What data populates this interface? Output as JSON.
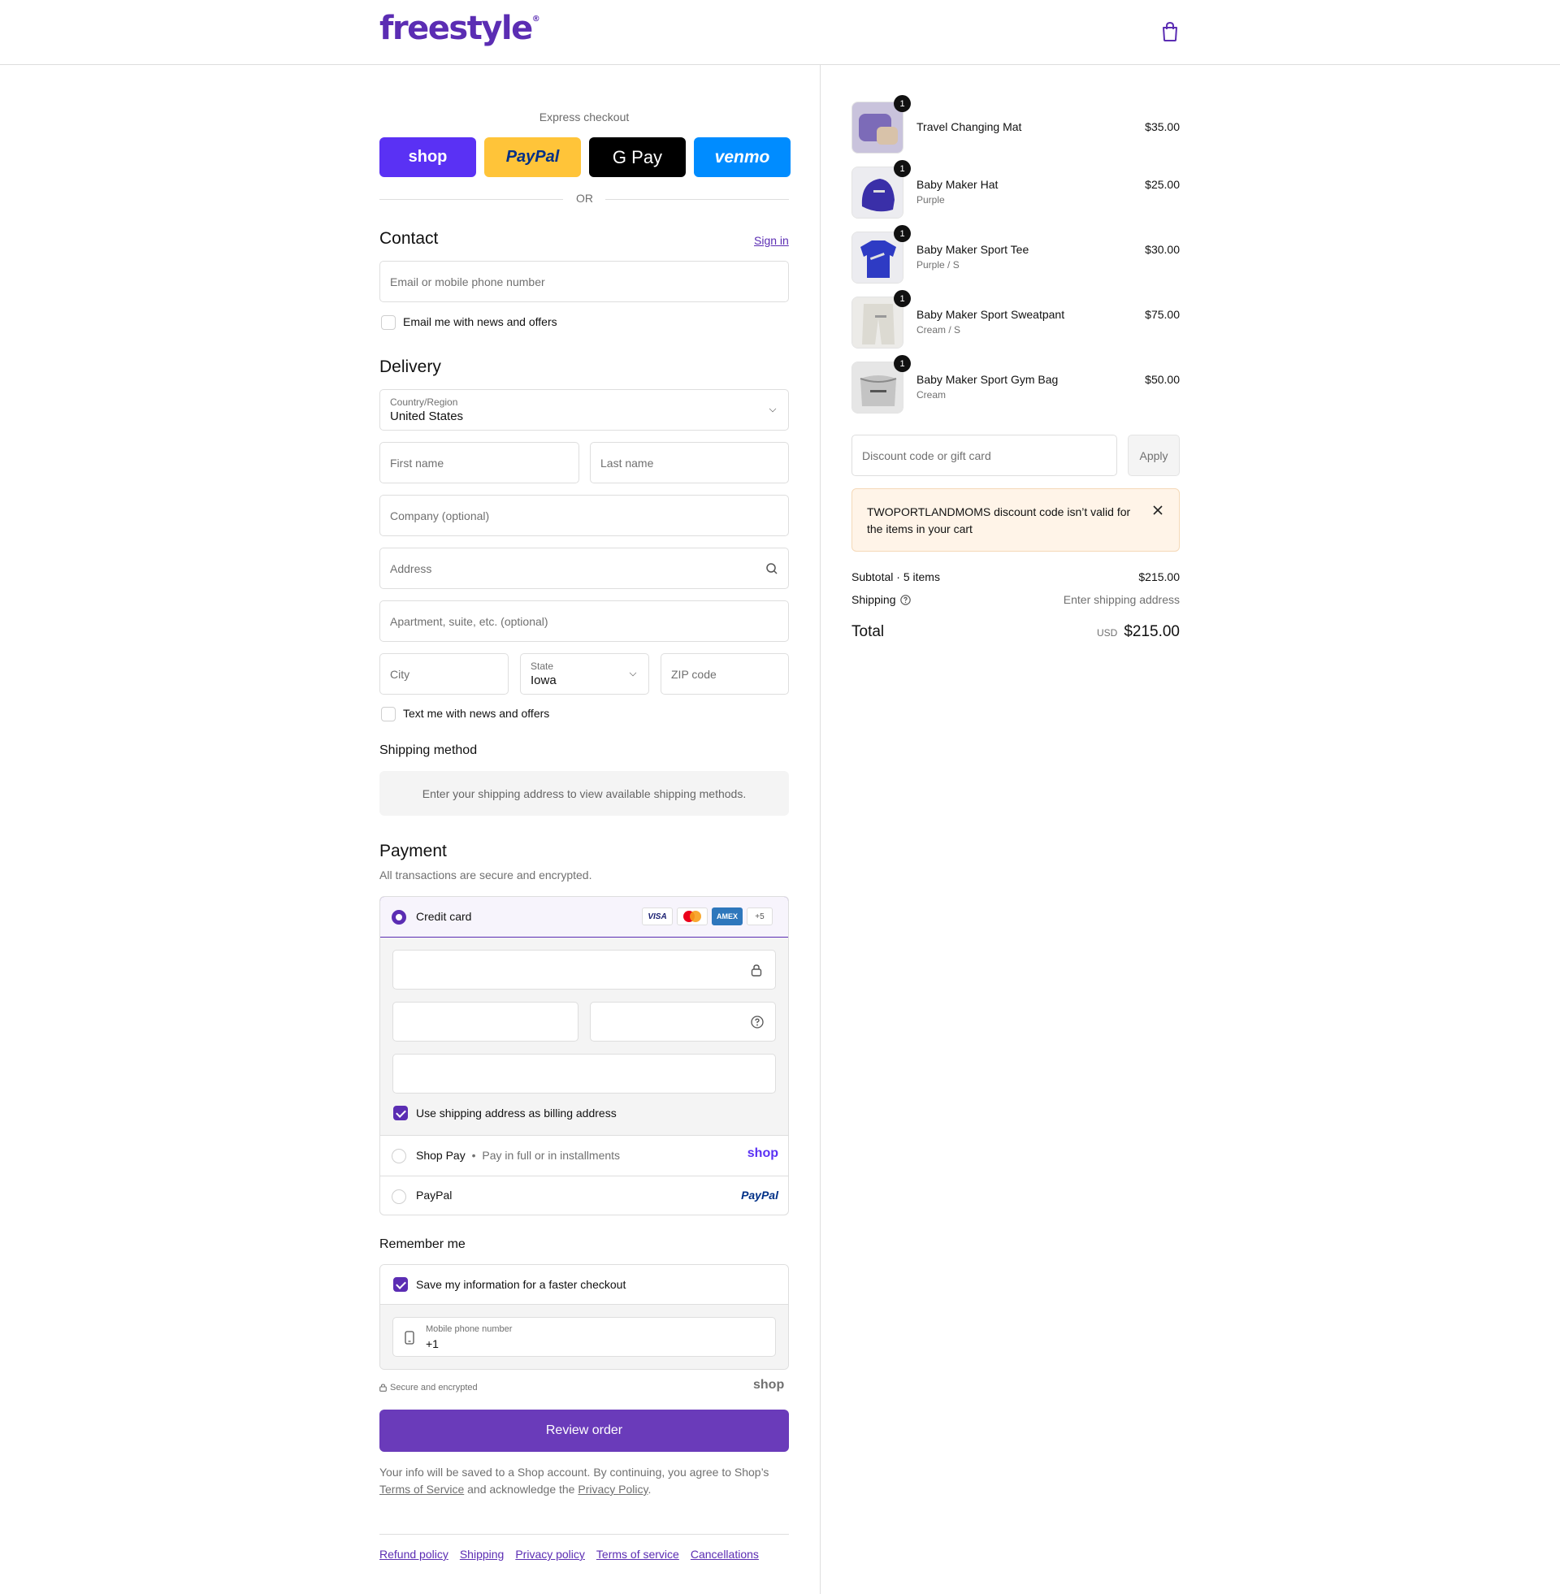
{
  "header": {
    "logo": "freestyle",
    "logo_mark": "®",
    "cart_icon": "shopping-bag-icon"
  },
  "express": {
    "title": "Express checkout",
    "buttons": [
      "shop",
      "PayPal",
      "G Pay",
      "venmo"
    ],
    "divider": "OR"
  },
  "contact": {
    "title": "Contact",
    "sign_in": "Sign in",
    "email_placeholder": "Email or mobile phone number",
    "news_label": "Email me with news and offers"
  },
  "delivery": {
    "title": "Delivery",
    "country_label": "Country/Region",
    "country_value": "United States",
    "first_name": "First name",
    "last_name": "Last name",
    "company": "Company (optional)",
    "address": "Address",
    "apartment": "Apartment, suite, etc. (optional)",
    "city": "City",
    "state_label": "State",
    "state_value": "Iowa",
    "zip": "ZIP code",
    "text_label": "Text me with news and offers"
  },
  "shipping_method": {
    "title": "Shipping method",
    "message": "Enter your shipping address to view available shipping methods."
  },
  "payment": {
    "title": "Payment",
    "subtitle": "All transactions are secure and encrypted.",
    "credit_card": "Credit card",
    "card_brands": [
      "VISA",
      "MC",
      "AMEX",
      "+5"
    ],
    "billing_label": "Use shipping address as billing address",
    "shop_pay": "Shop Pay",
    "shop_pay_sub": "Pay in full or in installments",
    "shop_pay_logo": "shop",
    "paypal": "PayPal",
    "paypal_logo": "PayPal"
  },
  "remember": {
    "title": "Remember me",
    "save_label": "Save my information for a faster checkout",
    "phone_label": "Mobile phone number",
    "phone_value": "+1",
    "secure": "Secure and encrypted",
    "shop_logo": "shop"
  },
  "review_button": "Review order",
  "legal": {
    "line1": "Your info will be saved to a Shop account. By continuing, you agree to Shop’s",
    "terms": "Terms of Service",
    "and_ack": "and acknowledge the",
    "privacy": "Privacy Policy",
    "end": "."
  },
  "footer_links": [
    "Refund policy",
    "Shipping",
    "Privacy policy",
    "Terms of service",
    "Cancellations"
  ],
  "cart": {
    "items": [
      {
        "name": "Travel Changing Mat",
        "variant": "",
        "price": "$35.00",
        "qty": "1"
      },
      {
        "name": "Baby Maker Hat",
        "variant": "Purple",
        "price": "$25.00",
        "qty": "1"
      },
      {
        "name": "Baby Maker Sport Tee",
        "variant": "Purple / S",
        "price": "$30.00",
        "qty": "1"
      },
      {
        "name": "Baby Maker Sport Sweatpant",
        "variant": "Cream / S",
        "price": "$75.00",
        "qty": "1"
      },
      {
        "name": "Baby Maker Sport Gym Bag",
        "variant": "Cream",
        "price": "$50.00",
        "qty": "1"
      }
    ],
    "discount_placeholder": "Discount code or gift card",
    "apply": "Apply",
    "error": "TWOPORTLANDMOMS discount code isn’t valid for the items in your cart",
    "subtotal_label": "Subtotal · 5 items",
    "subtotal_value": "$215.00",
    "shipping_label": "Shipping",
    "shipping_value": "Enter shipping address",
    "total_label": "Total",
    "currency": "USD",
    "total_value": "$215.00"
  },
  "colors": {
    "brand": "#5b2db3",
    "shop": "#5a31f4",
    "paypal": "#ffc439",
    "venmo": "#008cff",
    "error_bg": "#fff4e8"
  }
}
